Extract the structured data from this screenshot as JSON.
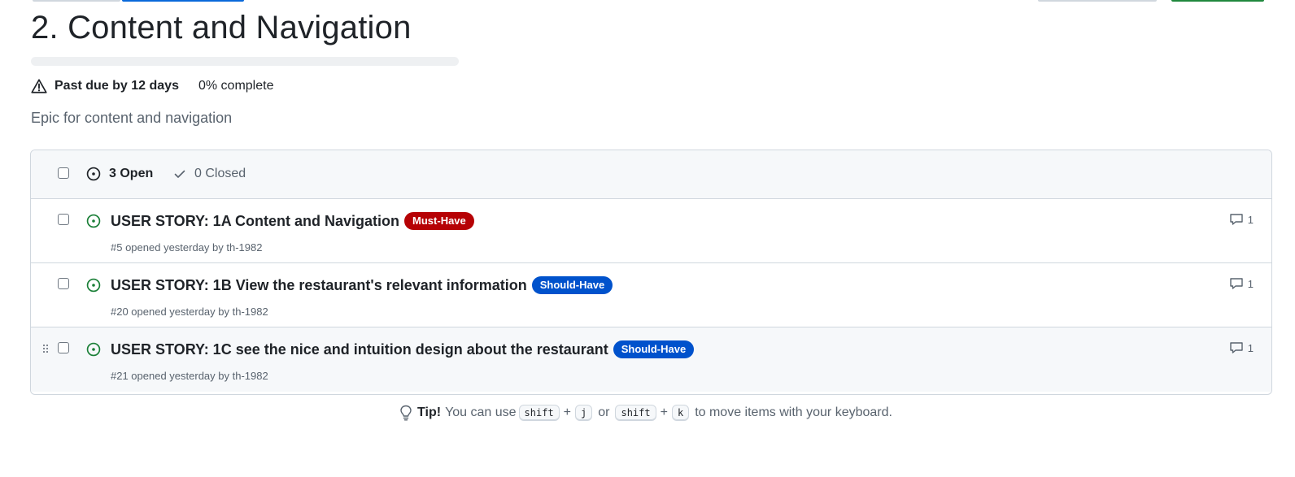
{
  "milestone": {
    "title": "2. Content and Navigation",
    "progress_percent": 0,
    "past_due": "Past due by 12 days",
    "complete": "0% complete",
    "description": "Epic for content and navigation"
  },
  "issues_header": {
    "open": "3 Open",
    "closed": "0 Closed"
  },
  "issues": [
    {
      "title": "USER STORY: 1A Content and Navigation",
      "label": "Must-Have",
      "label_color": "#b60205",
      "meta": "#5 opened yesterday by th-1982",
      "comments": "1"
    },
    {
      "title": "USER STORY: 1B View the restaurant's relevant information",
      "label": "Should-Have",
      "label_color": "#0052cc",
      "meta": "#20 opened yesterday by th-1982",
      "comments": "1"
    },
    {
      "title": "USER STORY: 1C see the nice and intuition design about the restaurant",
      "label": "Should-Have",
      "label_color": "#0052cc",
      "meta": "#21 opened yesterday by th-1982",
      "comments": "1"
    }
  ],
  "tip": {
    "strong": "Tip!",
    "prefix": "You can use",
    "key_shift": "shift",
    "plus": "+",
    "key_j": "j",
    "or": "or",
    "key_k": "k",
    "suffix": "to move items with your keyboard."
  },
  "colors": {
    "open_green": "#1a7f37",
    "progress_green": "#1f883d"
  }
}
